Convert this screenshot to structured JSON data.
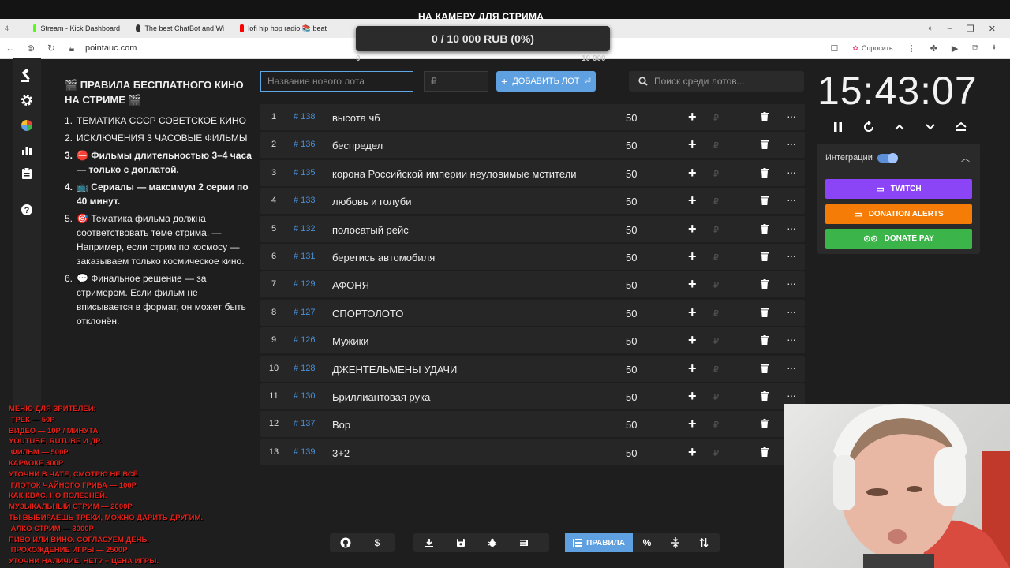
{
  "stream_overlay": {
    "title": "НА КАМЕРУ ДЛЯ СТРИМА",
    "progress_text": "0 / 10 000 RUB (0%)",
    "progress_fraction": 0,
    "progress_min": "0",
    "progress_max": "10 000"
  },
  "browser": {
    "tabs": [
      {
        "label": "4",
        "icon": "tab-count",
        "color": "#777777"
      },
      {
        "label": "Stream - Kick Dashboard",
        "icon": "kick-icon",
        "color": "#53fc18"
      },
      {
        "label": "The best ChatBot and Wi",
        "icon": "chatbot-icon",
        "color": "#333333"
      },
      {
        "label": "lofi hip hop radio 📚 beat",
        "icon": "youtube-icon",
        "color": "#ff0000"
      }
    ],
    "url": "pointauc.com",
    "ask_label": "Спросить"
  },
  "rules": {
    "title": "🎬 ПРАВИЛА БЕСПЛАТНОГО КИНО НА СТРИМЕ 🎬",
    "items": [
      {
        "num": "1.",
        "text": "ТЕМАТИКА СССР СОВЕТСКОЕ КИНО"
      },
      {
        "num": "2.",
        "text": "ИСКЛЮЧЕНИЯ  3 ЧАСОВЫЕ ФИЛЬМЫ"
      },
      {
        "num": "3.",
        "text": "⛔ Фильмы длительностью 3–4 часа — только с доплатой."
      },
      {
        "num": "4.",
        "text": "📺 Сериалы — максимум 2 серии по 40 минут."
      },
      {
        "num": "5.",
        "text": "🎯 Тематика фильма должна соответствовать теме стрима. — Например, если стрим по космосу — заказываем только космическое кино."
      },
      {
        "num": "6.",
        "text": "💬 Финальное решение — за стримером. Если фильм не вписывается в формат, он может быть отклонён."
      }
    ]
  },
  "toolbar": {
    "new_lot_placeholder": "Название нового лота",
    "amount_placeholder": "₽",
    "add_label": "ДОБАВИТЬ ЛОТ",
    "search_placeholder": "Поиск среди лотов..."
  },
  "lots": [
    {
      "index": "1",
      "id": "# 138",
      "name": "высота чб",
      "amount": "50"
    },
    {
      "index": "2",
      "id": "# 136",
      "name": "беспредел",
      "amount": "50"
    },
    {
      "index": "3",
      "id": "# 135",
      "name": "корона Российской империи неуловимые мстители",
      "amount": "50"
    },
    {
      "index": "4",
      "id": "# 133",
      "name": "любовь и голуби",
      "amount": "50"
    },
    {
      "index": "5",
      "id": "# 132",
      "name": "полосатый рейс",
      "amount": "50"
    },
    {
      "index": "6",
      "id": "# 131",
      "name": "берегись автомобиля",
      "amount": "50"
    },
    {
      "index": "7",
      "id": "# 129",
      "name": "АФОНЯ",
      "amount": "50"
    },
    {
      "index": "8",
      "id": "# 127",
      "name": "СПОРТОЛОТО",
      "amount": "50"
    },
    {
      "index": "9",
      "id": "# 126",
      "name": " Мужики",
      "amount": "50"
    },
    {
      "index": "10",
      "id": "# 128",
      "name": "ДЖЕНТЕЛЬМЕНЫ УДАЧИ",
      "amount": "50"
    },
    {
      "index": "11",
      "id": "# 130",
      "name": "Бриллиантовая рука",
      "amount": "50"
    },
    {
      "index": "12",
      "id": "# 137",
      "name": "Вор",
      "amount": "50"
    },
    {
      "index": "13",
      "id": "# 139",
      "name": "3+2",
      "amount": "50"
    }
  ],
  "lot_row": {
    "plus": "+",
    "currency": "₽",
    "more": "···"
  },
  "timer": {
    "value": "15:43:07"
  },
  "integrations": {
    "label": "Интеграции",
    "enabled": true,
    "buttons": [
      {
        "label": "TWITCH",
        "color": "#8c44f7"
      },
      {
        "label": "DONATION ALERTS",
        "color": "#f57d07"
      },
      {
        "label": "DONATE PAY",
        "color": "#3bb54a"
      }
    ]
  },
  "bottom_toolbar": {
    "rules_label": "ПРАВИЛА",
    "percent": "%"
  },
  "overlay_menu": {
    "lines": [
      "МЕНЮ ДЛЯ ЗРИТЕЛЕЙ:",
      " ТРЕК — 50Р",
      "ВИДЕО — 10Р / МИНУТА",
      "YOUTUBE, RUTUBE И ДР.",
      " ФИЛЬМ — 500Р",
      "КАРАОКЕ 300Р",
      "УТОЧНИ В ЧАТЕ, СМОТРЮ НЕ ВСЁ.",
      " ГЛОТОК ЧАЙНОГО ГРИБА — 100Р",
      "КАК КВАС, НО ПОЛЕЗНЕЙ.",
      "МУЗЫКАЛЬНЫЙ СТРИМ — 2000Р",
      "ТЫ ВЫБИРАЕШЬ ТРЕКИ, МОЖНО ДАРИТЬ ДРУГИМ.",
      " АЛКО СТРИМ — 3000Р",
      "ПИВО ИЛИ ВИНО. СОГЛАСУЕМ ДЕНЬ.",
      " ПРОХОЖДЕНИЕ ИГРЫ — 2500Р",
      "УТОЧНИ НАЛИЧИЕ. НЕТ? + ЦЕНА ИГРЫ."
    ]
  },
  "colors": {
    "accent": "#5ea0e0",
    "lot_id": "#4a90d9",
    "overlay_text": "#e0221b"
  }
}
